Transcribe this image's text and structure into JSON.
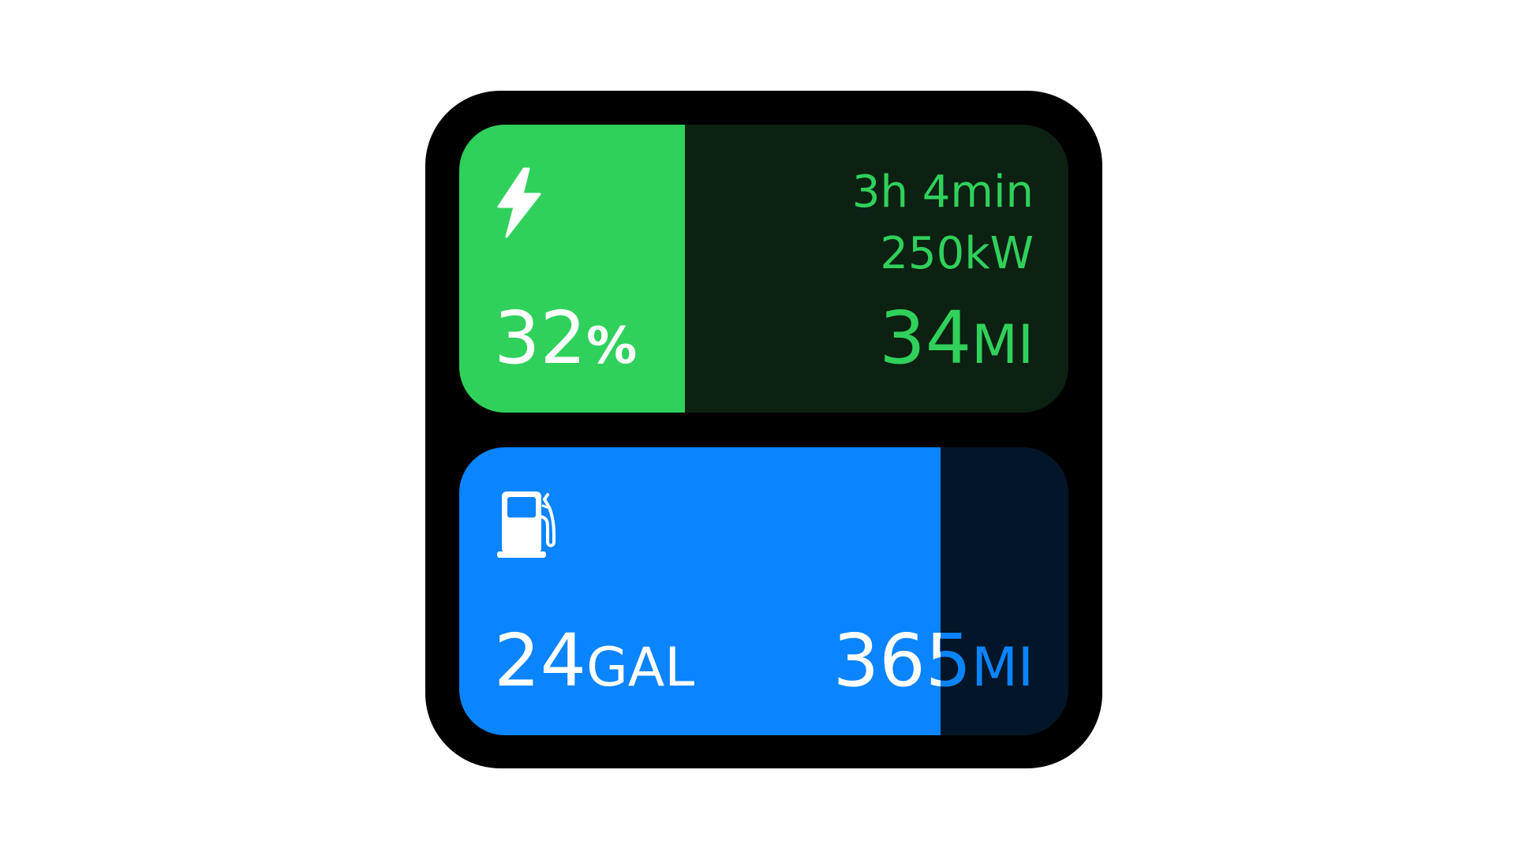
{
  "colors": {
    "ev_accent": "#30d15b",
    "ev_track": "#0c2112",
    "fuel_accent": "#0a84ff",
    "fuel_track": "#031629"
  },
  "ev": {
    "icon": "bolt-icon",
    "charge_level": 0.37,
    "percent_value": "32",
    "percent_unit": "%",
    "time_remaining": "3h 4min",
    "charge_rate": "250kW",
    "range_value": "34",
    "range_unit": "MI"
  },
  "fuel": {
    "icon": "fuel-pump-icon",
    "tank_level": 0.79,
    "volume_value": "24",
    "volume_unit": "GAL",
    "range_value": "365",
    "range_unit": "MI"
  }
}
